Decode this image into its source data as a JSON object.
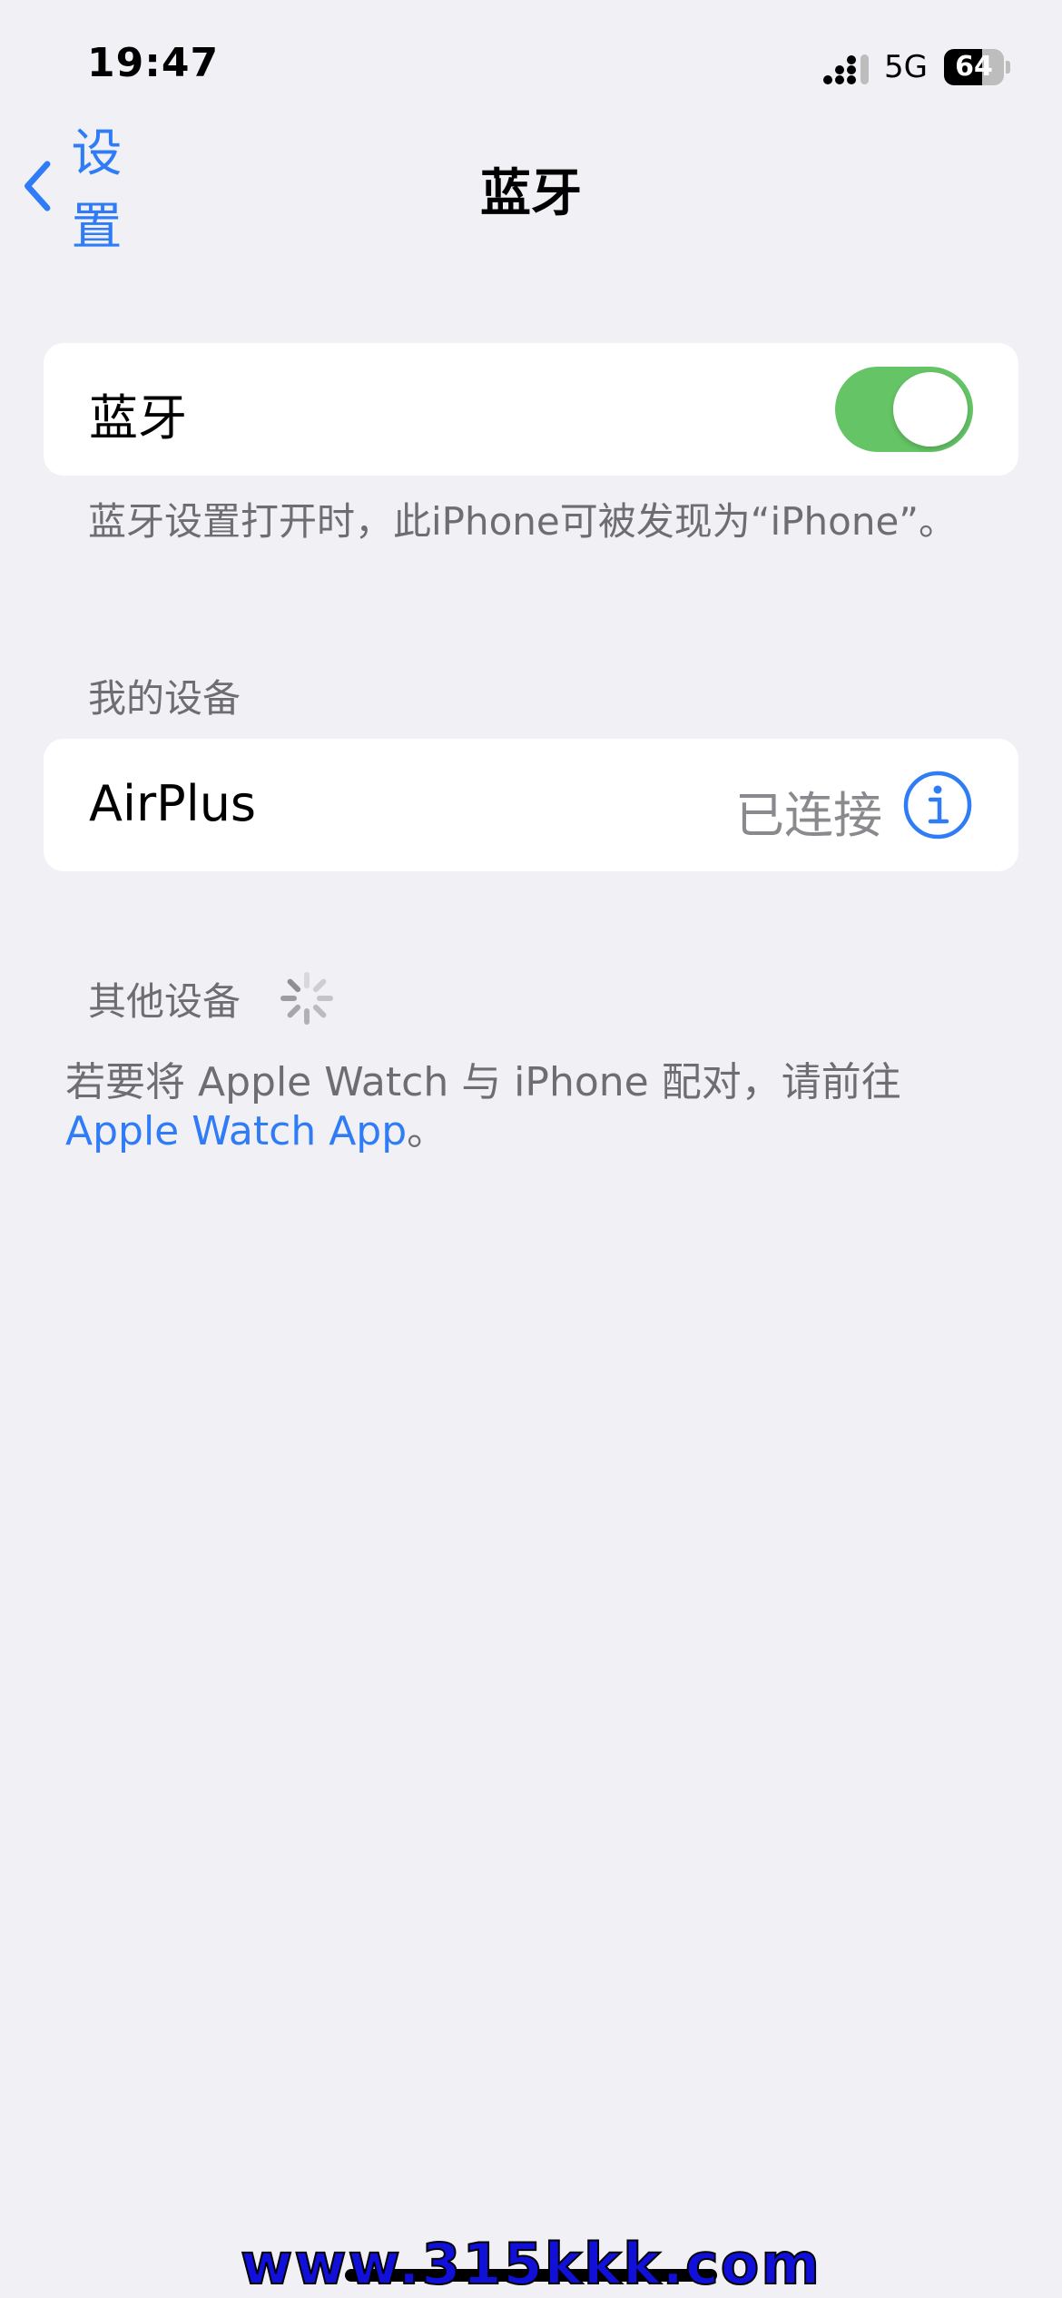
{
  "status_bar": {
    "time": "19:47",
    "network": "5G",
    "battery": "64",
    "battery_level": 0.64
  },
  "nav": {
    "back_label": "设置",
    "title": "蓝牙"
  },
  "bluetooth": {
    "label": "蓝牙",
    "enabled": true,
    "footer": "蓝牙设置打开时，此iPhone可被发现为“iPhone”。"
  },
  "my_devices": {
    "header": "我的设备",
    "items": [
      {
        "name": "AirPlus",
        "status": "已连接"
      }
    ]
  },
  "other_devices": {
    "header": "其他设备",
    "footer_text": "若要将 Apple Watch 与 iPhone 配对，请前往 ",
    "footer_link": "Apple Watch App",
    "footer_end": "。"
  },
  "watermark": "www.315kkk.com",
  "colors": {
    "accent": "#2f7cf6",
    "toggle_on": "#65c466",
    "background": "#f0f0f5"
  }
}
